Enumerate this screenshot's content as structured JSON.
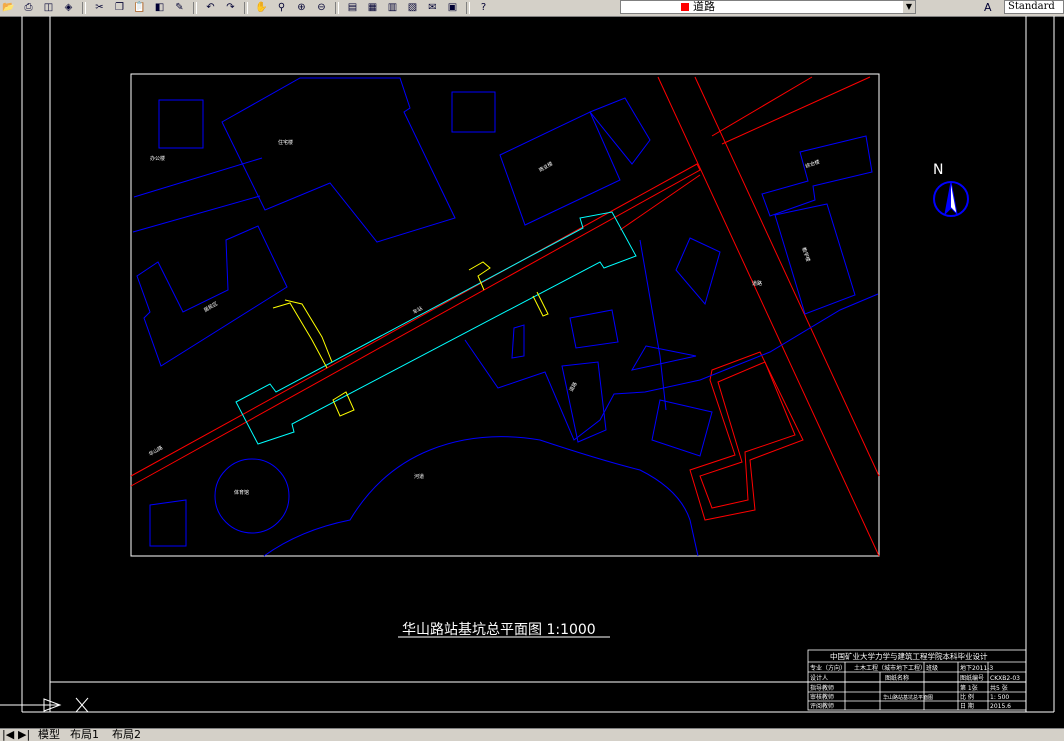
{
  "toolbar": {
    "icons": [
      "open-icon",
      "print-icon",
      "preview-icon",
      "publish-icon",
      "cut-icon",
      "copy-icon",
      "paste-icon",
      "match-icon",
      "brush-icon",
      "undo-icon",
      "redo-icon",
      "pan-icon",
      "zoom-icon",
      "zoom-window-icon",
      "zoom-prev-icon",
      "properties-icon",
      "design-center-icon",
      "tool-palette-icon",
      "sheet-set-icon",
      "markup-icon",
      "calc-icon",
      "help-icon"
    ],
    "layer_value": "道路",
    "text_style_value": "Standard"
  },
  "drawing": {
    "title": "华山路站基坑总平面图 1:1000",
    "north_label": "N",
    "title_block": {
      "header": "中国矿业大学力学与建筑工程学院本科毕业设计",
      "row1": [
        "专业（方向）",
        "土木工程（城市地下工程）",
        "班级",
        "地下2011-3"
      ],
      "row2": [
        "设计人",
        "",
        "图纸名称",
        "图纸编号",
        "CKXB2-03"
      ],
      "row3": [
        "指导教师",
        "",
        "第 1张",
        "共5 张"
      ],
      "row4": [
        "审核教师",
        "",
        "华山路站基坑总平面图",
        "比  例",
        "1: 500"
      ],
      "row5": [
        "评阅教师",
        "",
        "日  期",
        "2015.6"
      ]
    },
    "labels": {
      "roadA": "华山路",
      "roadB": "道路",
      "station": "车站",
      "bldg1": "办公楼",
      "bldg2": "住宅楼",
      "bldg3": "商业楼",
      "bldg4": "居民区",
      "bldg5": "综合楼",
      "bldg6": "教学楼",
      "bldg7": "体育馆",
      "bldg8": "河道",
      "bldg9": "道路"
    }
  },
  "tabs": {
    "model": "模型",
    "layout1": "布局1",
    "layout2": "布局2"
  },
  "colors": {
    "blue": "#0000ff",
    "red": "#ff0000",
    "cyan": "#00ffff",
    "yellow": "#ffff00",
    "white": "#ffffff"
  }
}
